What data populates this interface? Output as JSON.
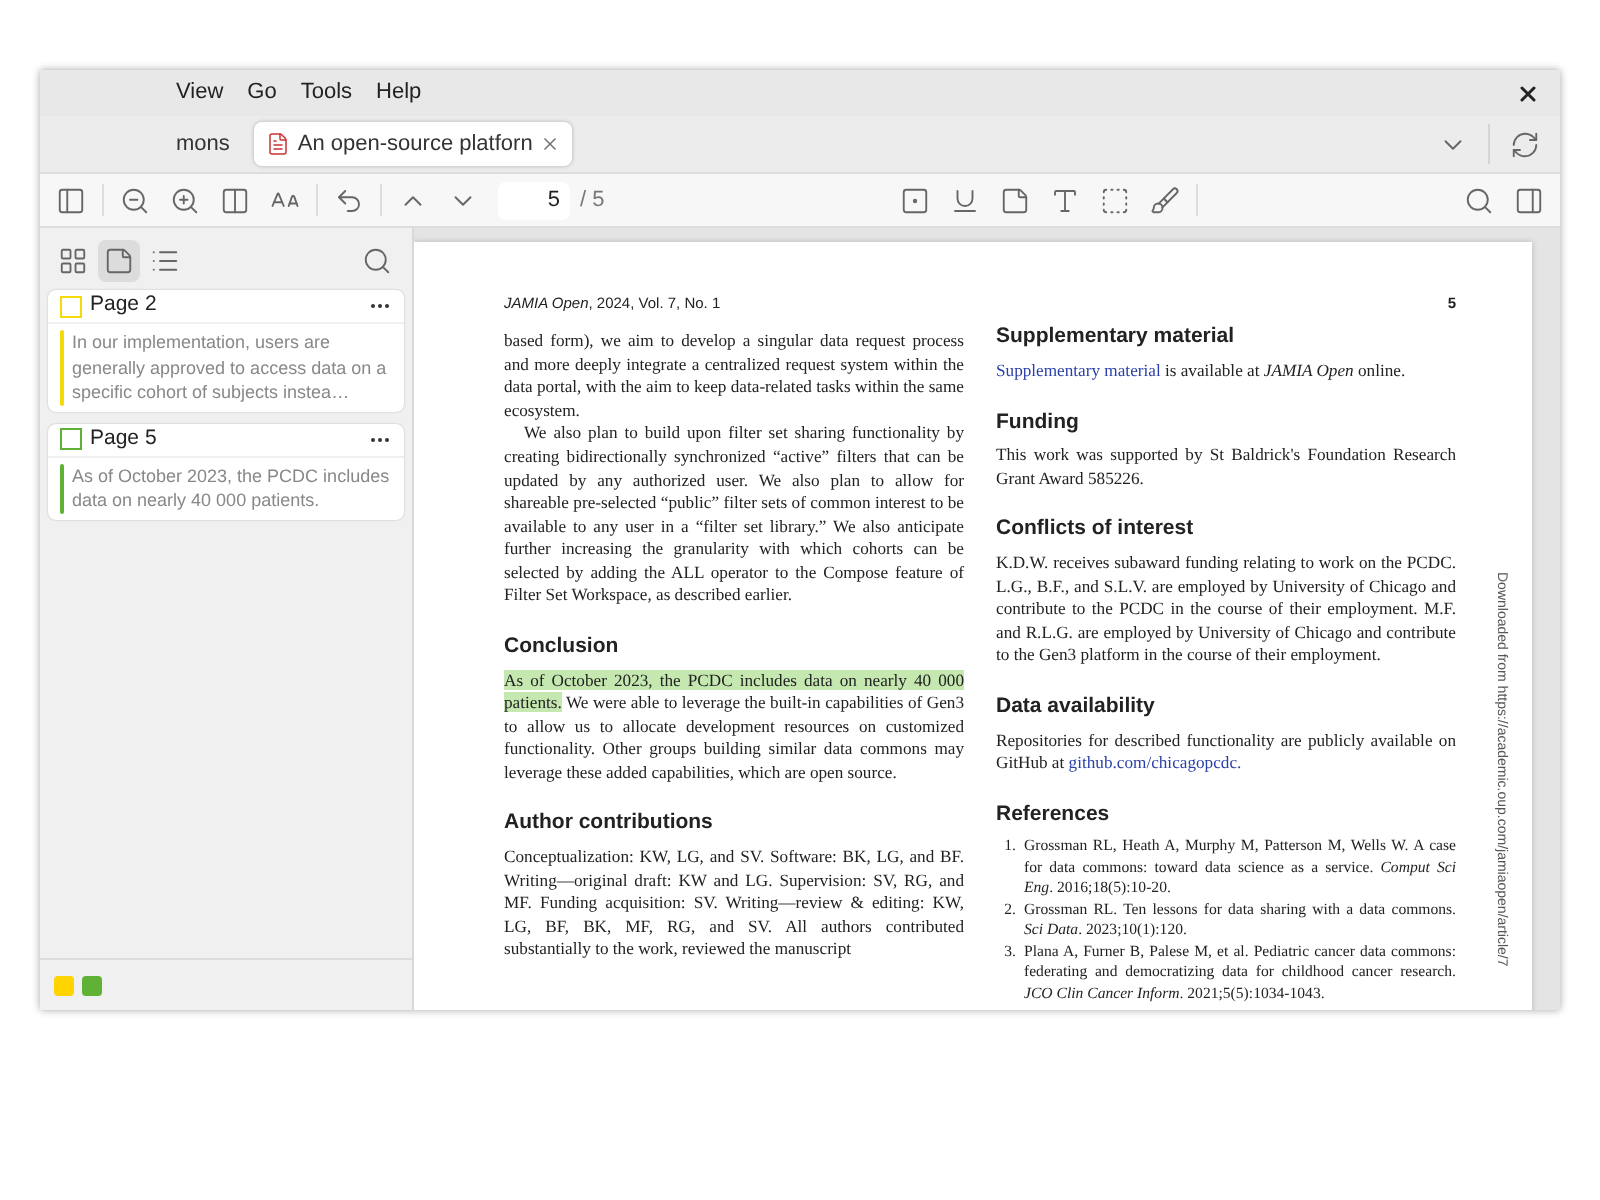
{
  "menu": [
    "View",
    "Go",
    "Tools",
    "Help"
  ],
  "tabs": [
    {
      "label": "mons",
      "kind": "library",
      "selected": false
    },
    {
      "label": "An open-source platforn",
      "kind": "pdf",
      "selected": true
    }
  ],
  "toolbar": {
    "page": "5",
    "page_total": "/ 5"
  },
  "sidebar": {
    "views": [
      {
        "kind": "thumbnails",
        "selected": false
      },
      {
        "kind": "annotations",
        "selected": true
      },
      {
        "kind": "outline",
        "selected": false
      }
    ],
    "annotations": [
      {
        "page": "Page 2",
        "color": "#f5d90a",
        "text": "In our implementation, users are generally approved to access data on a specific cohort of subjects instea…"
      },
      {
        "page": "Page 5",
        "color": "#5fb236",
        "text": "As of October 2023, the PCDC includes data on nearly 40 000 patients."
      }
    ],
    "filters": [
      {
        "color": "#ffd400"
      },
      {
        "color": "#5fb236"
      }
    ]
  },
  "document": {
    "header": "*JAMIA Open*, 2024, Vol. 7, No. 1",
    "page_number": "5",
    "left": [
      {
        "kind": "para",
        "text": "based form), we aim to develop a singular data request process and more deeply integrate a centralized request system within the data portal, with the aim to keep data-related tasks within the same ecosystem."
      },
      {
        "kind": "para",
        "indent": true,
        "text": "We also plan to build upon filter set sharing functionality by creating bidirectionally synchronized “active” filters that can be updated by any authorized user. We also plan to allow for shareable pre-selected “public” filter sets of common interest to be available to any user in a “filter set library.” We also anticipate further increasing the granularity with which cohorts can be selected by adding the ALL operator to the Compose feature of Filter Set Workspace, as described earlier."
      },
      {
        "kind": "heading",
        "text": "Conclusion"
      },
      {
        "kind": "para",
        "highlight": "As of October 2023, the PCDC includes data on nearly 40 000 patients.",
        "color": "#c5e8b0",
        "text": " We were able to leverage the built-in capabilities of Gen3 to allow us to allocate development resources on customized functionality. Other groups building similar data commons may leverage these added capabilities, which are open source."
      },
      {
        "kind": "heading",
        "text": "Author contributions"
      },
      {
        "kind": "para",
        "text": "Conceptualization: KW, LG, and SV. Software: BK, LG, and BF. Writing—original draft: KW and LG. Supervision: SV, RG, and MF. Funding acquisition: SV. Writing—review & editing: KW, LG, BF, BK, MF, RG, and SV. All authors contributed substantially to the work, reviewed the manuscript"
      }
    ],
    "right": [
      {
        "kind": "heading",
        "text": "Supplementary material"
      },
      {
        "kind": "para",
        "link": "Supplementary material",
        "text": " is available at *JAMIA Open* online."
      },
      {
        "kind": "heading",
        "text": "Funding"
      },
      {
        "kind": "para",
        "text": "This work was supported by St Baldrick's Foundation Research Grant Award 585226."
      },
      {
        "kind": "heading",
        "text": "Conflicts of interest"
      },
      {
        "kind": "para",
        "text": "K.D.W. receives subaward funding relating to work on the PCDC. L.G., B.F., and S.L.V. are employed by University of Chicago and contribute to the PCDC in the course of their employment. M.F. and R.L.G. are employed by University of Chicago and contribute to the Gen3 platform in the course of their employment."
      },
      {
        "kind": "heading",
        "text": "Data availability"
      },
      {
        "kind": "para",
        "text": "Repositories for described functionality are publicly available on GitHub at ",
        "link_after": "github.com/chicagopcdc."
      },
      {
        "kind": "heading",
        "text": "References"
      },
      {
        "kind": "refs",
        "items": [
          {
            "num": "1.",
            "text": "Grossman RL, Heath A, Murphy M, Patterson M, Wells W. A case for data commons: toward data science as a service. *Comput Sci Eng*. 2016;18(5):10-20."
          },
          {
            "num": "2.",
            "text": "Grossman RL. Ten lessons for data sharing with a data commons. *Sci Data*. 2023;10(1):120."
          },
          {
            "num": "3.",
            "text": "Plana A, Furner B, Palese M, et al. Pediatric cancer data commons: federating and democratizing data for childhood cancer research. *JCO Clin Cancer Inform*. 2021;5(5):1034-1043."
          }
        ]
      }
    ],
    "side_note": "Downloaded from https://academic.oup.com/jamiaopen/article/7"
  }
}
